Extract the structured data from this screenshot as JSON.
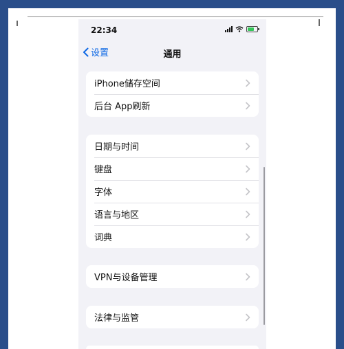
{
  "status_bar": {
    "time": "22:34"
  },
  "nav": {
    "back_label": "设置",
    "title": "通用"
  },
  "groups": [
    {
      "items": [
        {
          "label": "iPhone储存空间"
        },
        {
          "label": "后台 App刷新"
        }
      ]
    },
    {
      "items": [
        {
          "label": "日期与时间"
        },
        {
          "label": "键盘"
        },
        {
          "label": "字体"
        },
        {
          "label": "语言与地区"
        },
        {
          "label": "词典"
        }
      ]
    },
    {
      "items": [
        {
          "label": "VPN与设备管理"
        }
      ]
    },
    {
      "items": [
        {
          "label": "法律与监管"
        }
      ]
    }
  ],
  "colors": {
    "accent": "#0a66e4",
    "background": "#f2f2f7",
    "battery": "#34c759",
    "border_frame": "#2a4e8a"
  }
}
